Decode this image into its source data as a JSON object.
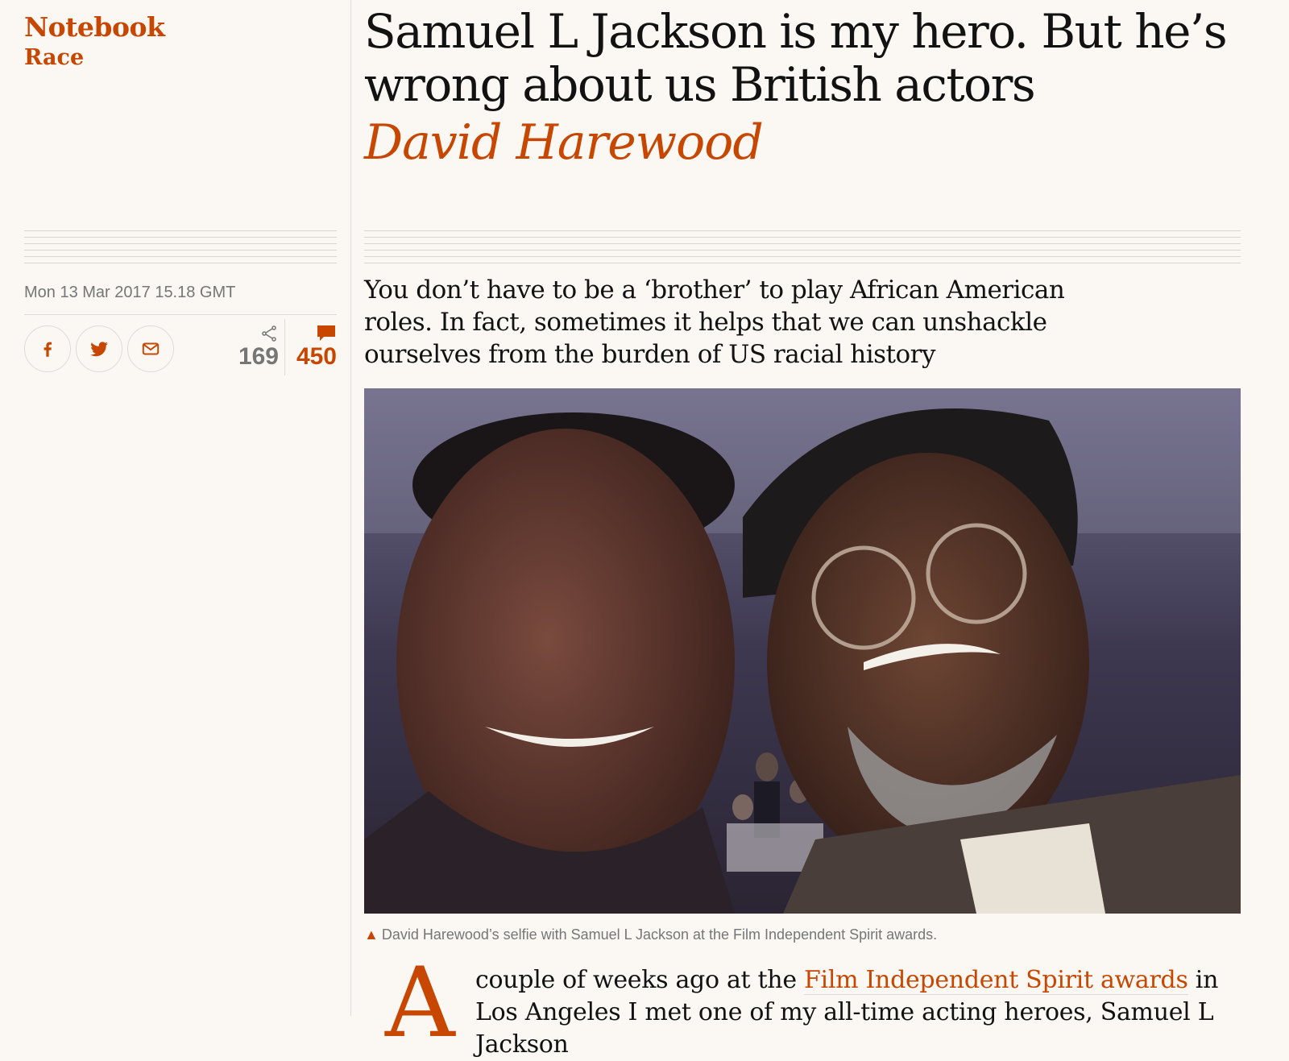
{
  "section": {
    "title": "Notebook",
    "subtitle": "Race"
  },
  "meta": {
    "date": "Mon 13 Mar 2017 15.18 GMT",
    "share_buttons": [
      {
        "icon": "facebook-icon"
      },
      {
        "icon": "twitter-icon"
      },
      {
        "icon": "email-icon"
      }
    ],
    "share_count": "169",
    "comment_count": "450"
  },
  "article": {
    "headline": "Samuel L Jackson is my hero. But he’s wrong about us British actors",
    "byline": "David Harewood",
    "standfirst": "You don’t have to be a ‘brother’ to play African American roles. In fact, sometimes it helps that we can unshackle ourselves from the burden of US racial history",
    "caption": "David Harewood’s selfie with Samuel L Jackson at the Film Independent Spirit awards.",
    "dropcap": "A",
    "body_before_link": "couple of weeks ago at the ",
    "body_link": "Film Independent Spirit awards",
    "body_after_link": " in Los Angeles I met one of my all-time acting heroes, Samuel L Jackson"
  },
  "colors": {
    "accent": "#c74600",
    "text": "#121212",
    "muted": "#767676",
    "background": "#fbf8f4"
  }
}
